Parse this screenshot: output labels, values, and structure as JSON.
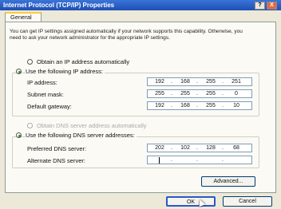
{
  "window": {
    "title": "Internet Protocol (TCP/IP) Properties",
    "help_label": "?",
    "close_label": "X"
  },
  "tabs": [
    {
      "label": "General"
    }
  ],
  "description": "You can get IP settings assigned automatically if your network supports this capability. Otherwise, you need to ask your network administrator for the appropriate IP settings.",
  "ip": {
    "auto_label": "Obtain an IP address automatically",
    "manual_label": "Use the following IP address:",
    "selected": "manual",
    "fields": [
      {
        "label": "IP address:",
        "octets": [
          "192",
          "168",
          "255",
          "251"
        ]
      },
      {
        "label": "Subnet mask:",
        "octets": [
          "255",
          "255",
          "255",
          "0"
        ]
      },
      {
        "label": "Default gateway:",
        "octets": [
          "192",
          "168",
          "255",
          "10"
        ]
      }
    ]
  },
  "dns": {
    "auto_label": "Obtain DNS server address automatically",
    "manual_label": "Use the following DNS server addresses:",
    "selected": "manual",
    "fields": [
      {
        "label": "Preferred DNS server:",
        "octets": [
          "202",
          "102",
          "128",
          "68"
        ]
      },
      {
        "label": "Alternate DNS server:",
        "octets": [
          "",
          "",
          "",
          ""
        ]
      }
    ]
  },
  "buttons": {
    "advanced": "Advanced...",
    "ok": "OK",
    "cancel": "Cancel"
  }
}
